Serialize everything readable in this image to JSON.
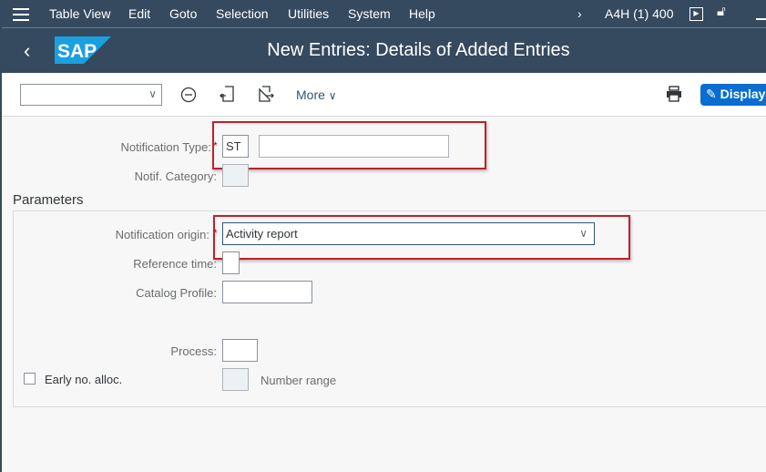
{
  "menubar": {
    "items": [
      "Table View",
      "Edit",
      "Goto",
      "Selection",
      "Utilities",
      "System",
      "Help"
    ],
    "system_info": "A4H (1) 400"
  },
  "header": {
    "title": "New Entries: Details of Added Entries",
    "logo_text": "SAP"
  },
  "toolbar": {
    "more_label": "More",
    "display_label": "Display"
  },
  "form": {
    "notification_type_label": "Notification Type:",
    "notification_type_value": "ST",
    "notification_type_desc": "",
    "notif_category_label": "Notif. Category:",
    "parameters_title": "Parameters",
    "notification_origin_label": "Notification origin:",
    "notification_origin_value": "Activity report",
    "reference_time_label": "Reference time:",
    "catalog_profile_label": "Catalog Profile:",
    "process_label": "Process:",
    "early_no_alloc_label": "Early no. alloc.",
    "number_range_label": "Number range",
    "required_marker": "*"
  }
}
